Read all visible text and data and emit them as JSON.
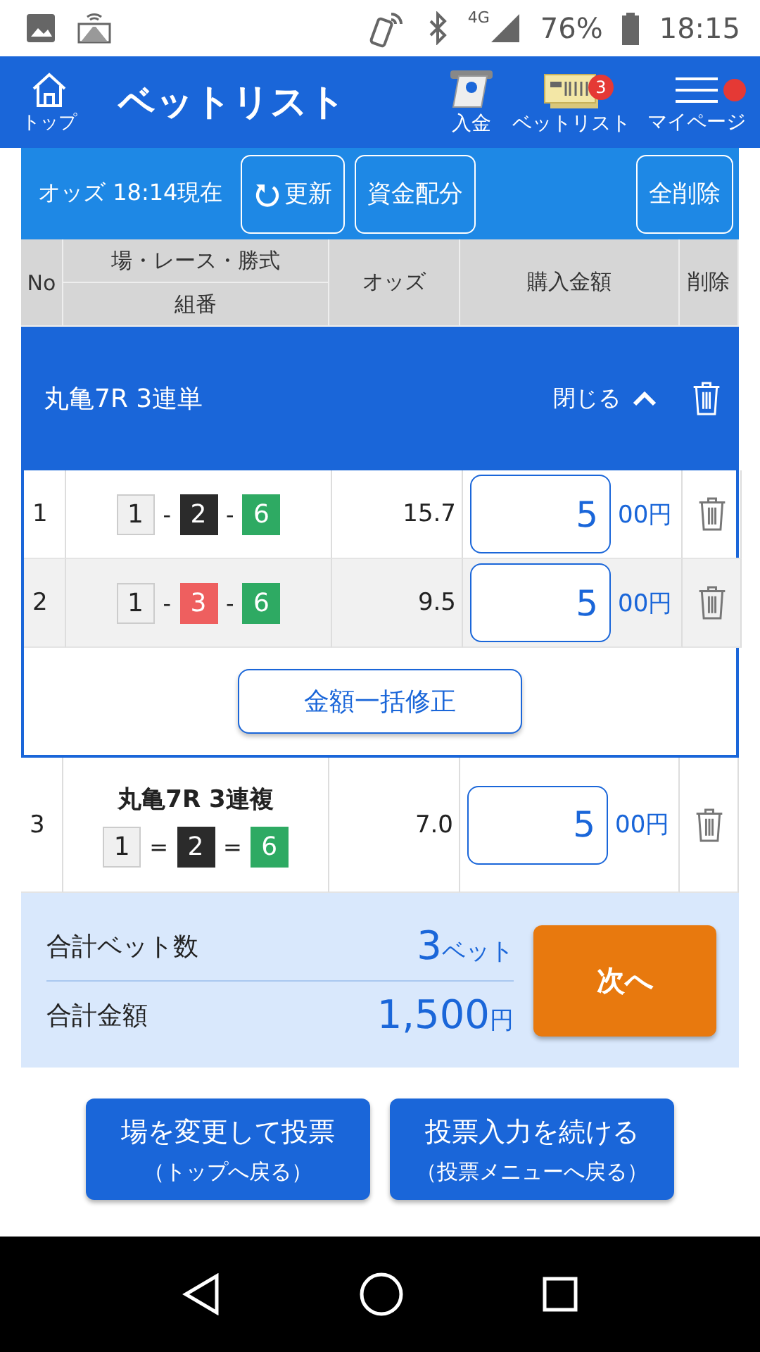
{
  "status_bar": {
    "battery": "76%",
    "network": "4G",
    "time": "18:15"
  },
  "header": {
    "home_label": "トップ",
    "title": "ベットリスト",
    "actions": [
      {
        "kind": "deposit",
        "label": "入金"
      },
      {
        "kind": "betlist",
        "label": "ベットリスト",
        "badge": "3"
      },
      {
        "kind": "menu",
        "label": "マイページ",
        "dot": true
      }
    ]
  },
  "toolbar": {
    "odds_time": "オッズ 18:14現在",
    "refresh": "更新",
    "allocate": "資金配分",
    "delete_all": "全削除"
  },
  "table": {
    "columns": {
      "no": "No",
      "race": "場・レース・勝式",
      "combo": "組番",
      "odds": "オッズ",
      "amount": "購入金額",
      "delete": "削除"
    },
    "groups": [
      {
        "title": "丸亀7R 3連単",
        "toggle": "閉じる",
        "expanded": true,
        "bulk_button": "金額一括修正",
        "rows": [
          {
            "no": "1",
            "separator": "-",
            "numbers": [
              {
                "n": "1",
                "color": "#f0f0f0"
              },
              {
                "n": "2",
                "color": "#2b2b2b"
              },
              {
                "n": "6",
                "color": "#2eaa63"
              }
            ],
            "odds": "15.7",
            "amount": "5",
            "unit": "00円"
          },
          {
            "no": "2",
            "separator": "-",
            "numbers": [
              {
                "n": "1",
                "color": "#f0f0f0"
              },
              {
                "n": "3",
                "color": "#ee5f5f"
              },
              {
                "n": "6",
                "color": "#2eaa63"
              }
            ],
            "odds": "9.5",
            "amount": "5",
            "unit": "00円"
          }
        ]
      }
    ],
    "rows": [
      {
        "no": "3",
        "title": "丸亀7R 3連複",
        "separator": "=",
        "numbers": [
          {
            "n": "1",
            "color": "#f0f0f0"
          },
          {
            "n": "2",
            "color": "#2b2b2b"
          },
          {
            "n": "6",
            "color": "#2eaa63"
          }
        ],
        "odds": "7.0",
        "amount": "5",
        "unit": "00円"
      }
    ]
  },
  "summary": {
    "count_label": "合計ベット数",
    "count": "3",
    "count_unit": "ベット",
    "total_label": "合計金額",
    "total": "1,500",
    "total_unit": "円",
    "next": "次へ"
  },
  "bottom_buttons": [
    {
      "title": "場を変更して投票",
      "sub": "（トップへ戻る）"
    },
    {
      "title": "投票入力を続ける",
      "sub": "（投票メニューへ戻る）"
    }
  ]
}
